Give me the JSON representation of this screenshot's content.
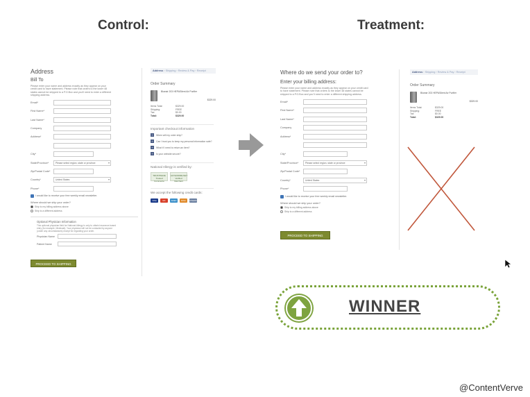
{
  "titles": {
    "control": "Control:",
    "treatment": "Treatment:"
  },
  "control": {
    "address_heading": "Address",
    "bill_to": "Bill To",
    "intro": "Please enter your name and address exactly as they appear on your credit card to have statement. Please note that orders to the lower 48 states cannot be shipped to a P.O.Box and you'll need to enter a different shipping address.",
    "fields": [
      {
        "label": "Email*",
        "value": ""
      },
      {
        "label": "First Name*",
        "value": ""
      },
      {
        "label": "Last Name*",
        "value": ""
      },
      {
        "label": "Company",
        "value": ""
      },
      {
        "label": "Address*",
        "value": ""
      },
      {
        "label": "",
        "value": ""
      },
      {
        "label": "City*",
        "value": ""
      },
      {
        "label": "State/Province*",
        "value": "Please select region, state or province"
      },
      {
        "label": "Zip/Postal Code*",
        "value": ""
      },
      {
        "label": "Country*",
        "value": "United States"
      },
      {
        "label": "Phone*",
        "value": ""
      }
    ],
    "newsletter": "I would like to receive your free weekly email newsletter.",
    "ship_question": "Where should we ship your order?",
    "ship_options": [
      "Ship to my billing address above",
      "Ship to a different address"
    ],
    "optional_title": "Optional Physician Information",
    "optional_text": "This optional physician field for National Allergy is only to obtain insurance-based entry (for example, Medicaid). Your physician will not be contacted by anyone (under any circumstances) except for regarding your order.",
    "physician_fields": [
      "Physician Name",
      "Patient Name"
    ],
    "proceed": "PROCEED TO SHIPPING"
  },
  "control_sidebar": {
    "breadcrumb": [
      "Address",
      "Shipping",
      "Review & Pay",
      "Receipt"
    ],
    "order_summary": "Order Summary",
    "product_name": "Blueair 203 HEPASilent Air Purifier",
    "product_price": "$329.00",
    "totals": [
      {
        "k": "Items Total:",
        "v": "$329.00"
      },
      {
        "k": "Shipping:",
        "v": "FREE"
      },
      {
        "k": "Tax:",
        "v": "$0.00"
      },
      {
        "k": "Total:",
        "v": "$329.00"
      }
    ],
    "info_title": "Important checkout information",
    "info_items": [
      "When will my order ship?",
      "Can I trust you to keep my personal information safe?",
      "What if I need to return an item?",
      "Is your website secure?"
    ],
    "verified_title": "National Allergy is verified by:",
    "badges": [
      "TRUSTWAVE Trusted Commerce",
      "AUTHORIZE.NET Verified Merchant"
    ],
    "cards_title": "We accept the following credit cards:",
    "cards": [
      "VISA",
      "MC",
      "AMEX",
      "DISC",
      "DINERS"
    ]
  },
  "treatment": {
    "heading": "Where do we send your order to?",
    "subheading": "Enter your billing address:",
    "intro": "Please enter your name and address exactly as they appear on your credit card to have statement. Please note that orders to the lower 48 states cannot be shipped to a P.O.Box and you'll need to enter a different shipping address.",
    "fields": [
      {
        "label": "Email*",
        "value": ""
      },
      {
        "label": "First Name*",
        "value": ""
      },
      {
        "label": "Last Name*",
        "value": ""
      },
      {
        "label": "Company",
        "value": ""
      },
      {
        "label": "Address*",
        "value": ""
      },
      {
        "label": "",
        "value": ""
      },
      {
        "label": "City*",
        "value": ""
      },
      {
        "label": "State/Province*",
        "value": "Please select region, state or province"
      },
      {
        "label": "Zip/Postal Code*",
        "value": ""
      },
      {
        "label": "Country*",
        "value": "United States"
      },
      {
        "label": "Phone*",
        "value": ""
      }
    ],
    "newsletter": "I would like to receive your free weekly email newsletter.",
    "ship_question": "Where should we ship your order?",
    "ship_options": [
      "Ship to my billing address above",
      "Ship to a different address"
    ],
    "proceed": "PROCEED TO SHIPPING"
  },
  "treatment_sidebar": {
    "breadcrumb": [
      "Address",
      "Shipping",
      "Review & Pay",
      "Receipt"
    ],
    "order_summary": "Order Summary",
    "product_name": "Blueair 203 HEPASilent Air Purifier",
    "product_price": "$329.00",
    "totals": [
      {
        "k": "Items Total:",
        "v": "$329.00"
      },
      {
        "k": "Shipping:",
        "v": "FREE"
      },
      {
        "k": "Tax:",
        "v": "$0.00"
      },
      {
        "k": "Total:",
        "v": "$329.00"
      }
    ]
  },
  "winner": {
    "label": "WINNER"
  },
  "handle": "@ContentVerve",
  "colors": {
    "button": "#7d8a2f",
    "winner": "#7ea340",
    "cross": "#c0563a",
    "crumb": "#4a5c85"
  },
  "icons": {
    "arrow": "arrow-right-icon",
    "winner": "arrow-up-icon",
    "cross": "cross-out-icon",
    "cursor": "mouse-cursor-icon"
  }
}
